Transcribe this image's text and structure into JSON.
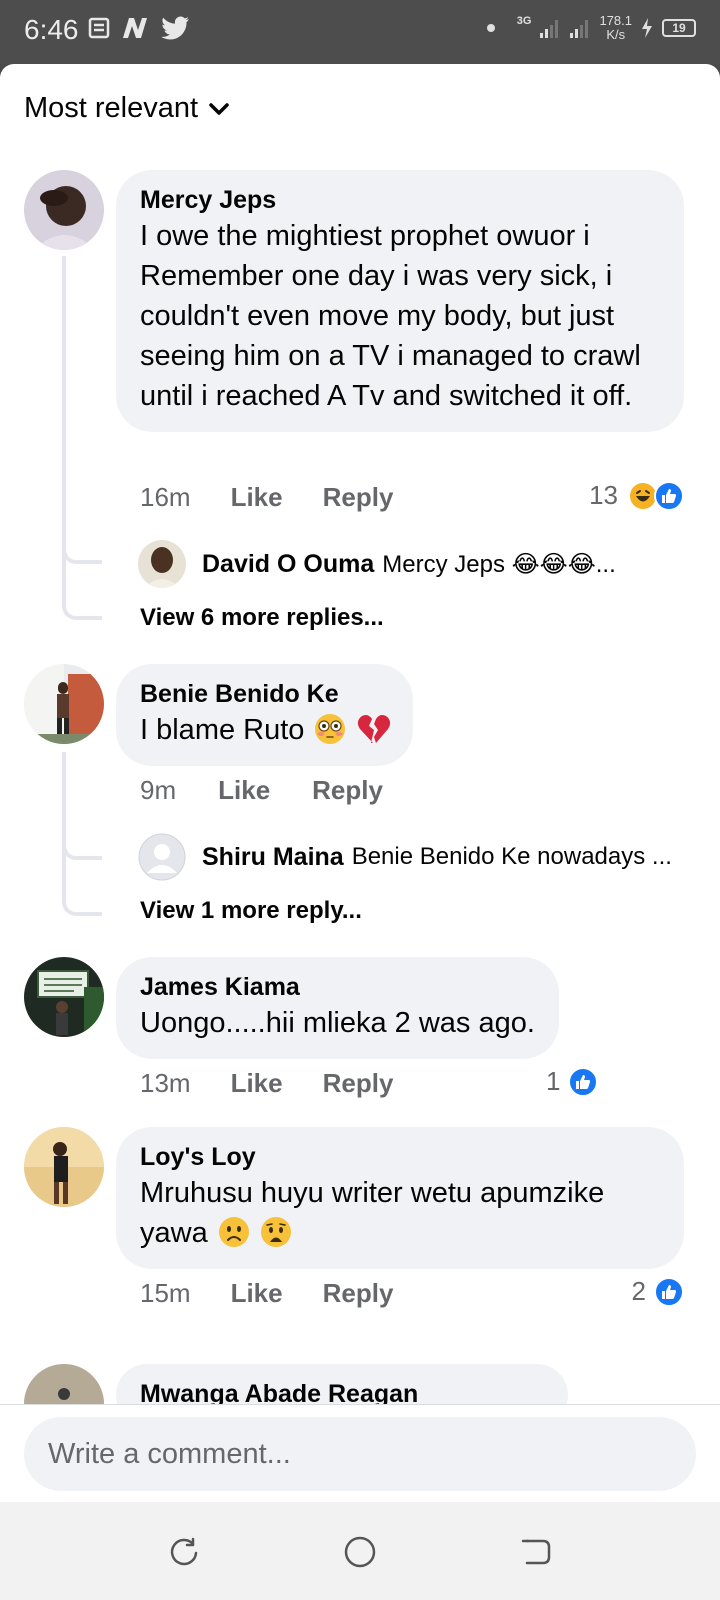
{
  "status_bar": {
    "time": "6:46",
    "network_type": "3G",
    "speed_value": "178.1",
    "speed_unit": "K/s",
    "battery": "19"
  },
  "sort": {
    "label": "Most relevant"
  },
  "comments": [
    {
      "author": "Mercy Jeps",
      "text": "I owe the mightiest prophet owuor i Remember one day i was very sick, i couldn't even move my body, but just seeing him on a TV i managed to crawl until i reached A Tv and switched it off.",
      "time": "16m",
      "like_label": "Like",
      "reply_label": "Reply",
      "reaction_count": "13",
      "reactions": [
        "haha-icon",
        "like-icon"
      ],
      "reply_preview": {
        "author": "David O Ouma",
        "text": "Mercy Jeps 😂😂😂..."
      },
      "view_more": "View 6 more replies..."
    },
    {
      "author": "Benie Benido Ke",
      "text": "I blame Ruto",
      "text_emojis": [
        "flushed-face",
        "broken-heart"
      ],
      "time": "9m",
      "like_label": "Like",
      "reply_label": "Reply",
      "reply_preview": {
        "author": "Shiru Maina",
        "text": "Benie Benido Ke nowadays ..."
      },
      "view_more": "View 1 more reply..."
    },
    {
      "author": "James Kiama",
      "text": "Uongo.....hii mlieka 2 was ago.",
      "time": "13m",
      "like_label": "Like",
      "reply_label": "Reply",
      "reaction_count": "1",
      "reactions": [
        "like-icon"
      ]
    },
    {
      "author": "Loy's Loy",
      "text": "Mruhusu huyu writer wetu apumzike yawa",
      "text_emojis": [
        "frowning-face",
        "anguished-face"
      ],
      "time": "15m",
      "like_label": "Like",
      "reply_label": "Reply",
      "reaction_count": "2",
      "reactions": [
        "like-icon"
      ]
    },
    {
      "author": "Mwanga Abade Reagan"
    }
  ],
  "composer": {
    "placeholder": "Write a comment..."
  },
  "colors": {
    "bubble": "#f0f2f5",
    "like_blue": "#1877f2",
    "secondary_text": "#65676b"
  }
}
